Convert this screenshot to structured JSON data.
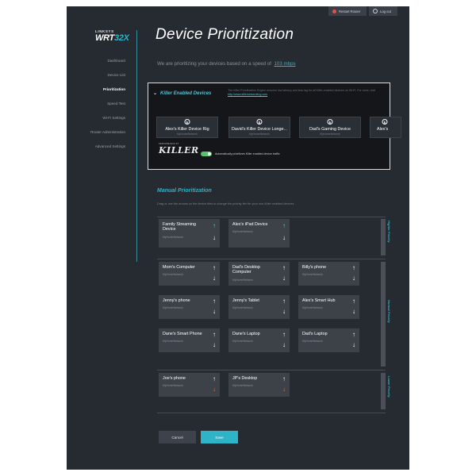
{
  "header": {
    "restart_label": "Restart Router",
    "logout_label": "Log out"
  },
  "logo": {
    "brand": "LINKSYS",
    "model_prefix": "WRT",
    "model_suffix": "32X"
  },
  "sidebar": {
    "items": [
      {
        "label": "Dashboard"
      },
      {
        "label": "Device List"
      },
      {
        "label": "Prioritization"
      },
      {
        "label": "Speed Test"
      },
      {
        "label": "Wi-Fi Settings"
      },
      {
        "label": "Router Administration"
      },
      {
        "label": "Advanced Settings"
      }
    ]
  },
  "page": {
    "title": "Device Prioritization",
    "subtitle_prefix": "We are prioritizing your devices based on a speed of",
    "speed": "103 mbps"
  },
  "killer": {
    "heading": "Killer Enabled Devices",
    "description": "The Killer Prioritization Engine ensures low latency and less lag for all Killer-enabled devices on Wi-Fi. For more, visit",
    "link": "http://www.killernetworking.com",
    "devices": [
      {
        "name": "Alex's Killer Device Rig",
        "network": "MyHomeNetwork"
      },
      {
        "name": "David's Killer Device Longe...",
        "network": "MyHomeNetwork"
      },
      {
        "name": "Dad's Gaming Device",
        "network": "MyHomeNetwork"
      },
      {
        "name": "Alex's",
        "network": ""
      }
    ],
    "logo_tagline": "PERFORMANCE BY",
    "logo_text": "KILLER",
    "toggle_label": "Automatically prioritizes Killer enabled device traffic"
  },
  "manual": {
    "title": "Manual Prioritization",
    "description": "Drag or use the arrows on the device tiles to change the priority tier for your non-Killer enabled devices.",
    "tiers": {
      "higher": "Higher Priority",
      "normal": "Normal Priority",
      "lower": "Lower Priority"
    },
    "higher_devices": [
      {
        "name": "Family Streaming Device",
        "network": "MyHomeNetwork"
      },
      {
        "name": "Alex's iPad Device",
        "network": "MyHomeNetwork"
      }
    ],
    "normal_devices": [
      {
        "name": "Mom's Computer",
        "network": "MyHomeNetwork"
      },
      {
        "name": "Dad's Desktop Computer",
        "network": "MyHomeNetwork"
      },
      {
        "name": "Billy's phone",
        "network": "MyHomeNetwork"
      },
      {
        "name": "Jenny's phone",
        "network": "MyHomeNetwork"
      },
      {
        "name": "Jenny's Tablet",
        "network": "MyHomeNetwork"
      },
      {
        "name": "Alex's Smart Hub",
        "network": "MyHomeNetwork"
      },
      {
        "name": "Dane's Smart Phone",
        "network": "MyHomeNetwork"
      },
      {
        "name": "Dane's Laptop",
        "network": "MyHomeNetwork"
      },
      {
        "name": "Dad's Laptop",
        "network": "MyHomeNetwork"
      }
    ],
    "lower_devices": [
      {
        "name": "Joe's phone",
        "network": "MyHomeNetwork"
      },
      {
        "name": "JP's Desktop",
        "network": "MyHomeNetwork"
      }
    ]
  },
  "arrows": {
    "up": "↑",
    "down": "↓"
  },
  "footer": {
    "cancel_label": "Cancel",
    "save_label": "Save"
  },
  "colors": {
    "background": "#262a31",
    "accent": "#2fb3c7",
    "card": "#3d4249",
    "arrow_up_teal": "#5bd0e0",
    "arrow_down_red": "#e36a5e",
    "save_button": "#2fb3c7",
    "cancel_button": "#3e434b"
  }
}
